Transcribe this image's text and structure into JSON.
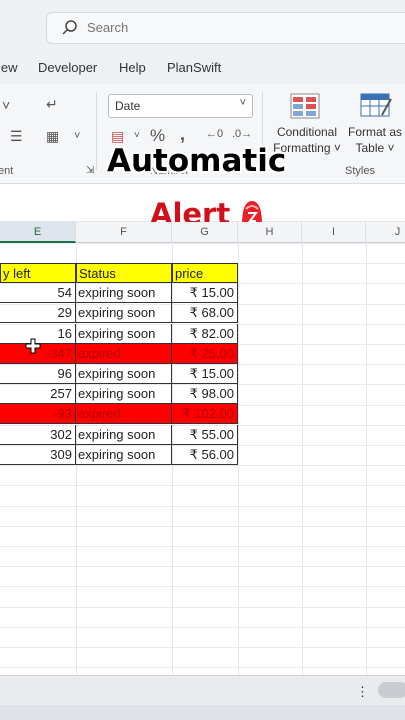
{
  "search": {
    "placeholder": "Search"
  },
  "tabs": [
    "iew",
    "Developer",
    "Help",
    "PlanSwift"
  ],
  "ribbon": {
    "number_format": "Date",
    "group_labels": {
      "alignment": "ent",
      "number": "Number",
      "styles": "Styles"
    },
    "conditional_formatting": [
      "Conditional",
      "Formatting ˅"
    ],
    "format_as_table": [
      "Format as",
      "Table ˅"
    ],
    "percent_symbol": "%",
    "comma_symbol": "١"
  },
  "overlay": {
    "line1": "Automatic",
    "line2": "Alert"
  },
  "columns": [
    "E",
    "F",
    "G",
    "H",
    "I",
    "J"
  ],
  "table": {
    "headers": [
      "y left",
      "Status",
      "price"
    ],
    "rows": [
      {
        "days": "54",
        "status": "expiring soon",
        "price": "₹ 15.00",
        "expired": false
      },
      {
        "days": "29",
        "status": "expiring soon",
        "price": "₹ 68.00",
        "expired": false
      },
      {
        "days": "16",
        "status": "expiring soon",
        "price": "₹ 82.00",
        "expired": false
      },
      {
        "days": "-347",
        "status": "expired",
        "price": "₹ 25.00",
        "expired": true
      },
      {
        "days": "96",
        "status": "expiring soon",
        "price": "₹ 15.00",
        "expired": false
      },
      {
        "days": "257",
        "status": "expiring soon",
        "price": "₹ 98.00",
        "expired": false
      },
      {
        "days": "-93",
        "status": "expired",
        "price": "₹ 102.00",
        "expired": true
      },
      {
        "days": "302",
        "status": "expiring soon",
        "price": "₹ 55.00",
        "expired": false
      },
      {
        "days": "309",
        "status": "expiring soon",
        "price": "₹ 56.00",
        "expired": false
      }
    ]
  },
  "colors": {
    "header_fill": "#ffff00",
    "expired_fill": "#ff0000",
    "overlay_red": "#d0101a"
  },
  "icons": [
    "search-icon",
    "siren-icon",
    "more-icon",
    "cursor-move-icon"
  ]
}
